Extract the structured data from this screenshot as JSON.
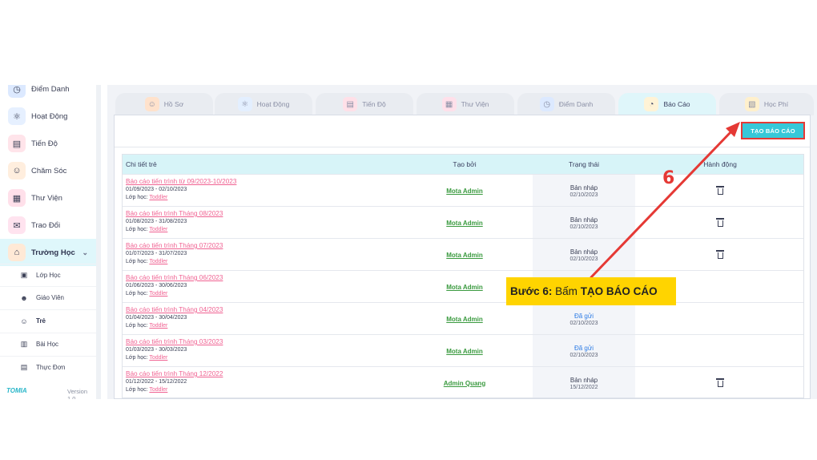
{
  "sidebar": {
    "items": [
      {
        "label": "Điểm Danh",
        "icon": "clock-icon",
        "color": "#dce9ff",
        "glyph": "◷"
      },
      {
        "label": "Hoạt Động",
        "icon": "atom-icon",
        "color": "#e6f0ff",
        "glyph": "⚛"
      },
      {
        "label": "Tiến Độ",
        "icon": "chart-board-icon",
        "color": "#ffe4ea",
        "glyph": "▤"
      },
      {
        "label": "Chăm Sóc",
        "icon": "baby-care-icon",
        "color": "#ffeede",
        "glyph": "☺"
      },
      {
        "label": "Thư Viện",
        "icon": "library-icon",
        "color": "#ffe0ea",
        "glyph": "▦"
      },
      {
        "label": "Trao Đổi",
        "icon": "chat-icon",
        "color": "#ffe3ef",
        "glyph": "✉"
      },
      {
        "label": "Trường Học",
        "icon": "school-icon",
        "color": "#ffe9d6",
        "glyph": "⌂"
      }
    ],
    "sub_items": [
      {
        "label": "Lớp Học",
        "icon": "classroom-icon",
        "glyph": "▣"
      },
      {
        "label": "Giáo Viên",
        "icon": "teachers-icon",
        "glyph": "☻"
      },
      {
        "label": "Trẻ",
        "icon": "kids-icon",
        "glyph": "☺"
      },
      {
        "label": "Bài Học",
        "icon": "lesson-icon",
        "glyph": "▥"
      },
      {
        "label": "Thực Đơn",
        "icon": "menu-icon",
        "glyph": "▤"
      }
    ],
    "brand": "TOMIA",
    "version": "Version 1.0"
  },
  "tabs": [
    {
      "label": "Hồ Sơ",
      "icon": "profile-icon",
      "color": "#ffe2cc",
      "glyph": "☺"
    },
    {
      "label": "Hoạt Động",
      "icon": "atom-icon",
      "color": "#e3efff",
      "glyph": "⚛"
    },
    {
      "label": "Tiến Độ",
      "icon": "chart-board-icon",
      "color": "#ffe0e8",
      "glyph": "▤"
    },
    {
      "label": "Thư Viện",
      "icon": "library-icon",
      "color": "#ffe0ea",
      "glyph": "▦"
    },
    {
      "label": "Điểm Danh",
      "icon": "clock-icon",
      "color": "#dce9ff",
      "glyph": "◷"
    },
    {
      "label": "Báo Cáo",
      "icon": "report-pie-icon",
      "color": "#fff3d6",
      "glyph": "◔"
    },
    {
      "label": "Học Phí",
      "icon": "tuition-icon",
      "color": "#fff0cc",
      "glyph": "▧"
    }
  ],
  "toolbar": {
    "create_label": "TẠO BÁO CÁO"
  },
  "table": {
    "headers": [
      "Chi tiết trẻ",
      "Tạo bởi",
      "Trạng thái",
      "Hành động"
    ],
    "rows": [
      {
        "title": "Báo cáo tiến trình từ 09/2023-10/2023",
        "range": "01/09/2023 - 02/10/2023",
        "class_prefix": "Lớp học:",
        "class_name": "Toddler",
        "creator": "Mota Admin",
        "status": "Bản nháp",
        "status_date": "02/10/2023",
        "sent": false,
        "deletable": true
      },
      {
        "title": "Báo cáo tiến trình Tháng 08/2023",
        "range": "01/08/2023 - 31/08/2023",
        "class_prefix": "Lớp học:",
        "class_name": "Toddler",
        "creator": "Mota Admin",
        "status": "Bản nháp",
        "status_date": "02/10/2023",
        "sent": false,
        "deletable": true
      },
      {
        "title": "Báo cáo tiến trình Tháng 07/2023",
        "range": "01/07/2023 - 31/07/2023",
        "class_prefix": "Lớp học:",
        "class_name": "Toddler",
        "creator": "Mota Admin",
        "status": "Bản nháp",
        "status_date": "02/10/2023",
        "sent": false,
        "deletable": true
      },
      {
        "title": "Báo cáo tiến trình Tháng 06/2023",
        "range": "01/06/2023 - 30/06/2023",
        "class_prefix": "Lớp học:",
        "class_name": "Toddler",
        "creator": "Mota Admin",
        "status": "",
        "status_date": "",
        "sent": false,
        "deletable": false
      },
      {
        "title": "Báo cáo tiến trình Tháng 04/2023",
        "range": "01/04/2023 - 30/04/2023",
        "class_prefix": "Lớp học:",
        "class_name": "Toddler",
        "creator": "Mota Admin",
        "status": "Đã gửi",
        "status_date": "02/10/2023",
        "sent": true,
        "deletable": false
      },
      {
        "title": "Báo cáo tiến trình Tháng 03/2023",
        "range": "01/03/2023 - 30/03/2023",
        "class_prefix": "Lớp học:",
        "class_name": "Toddler",
        "creator": "Mota Admin",
        "status": "Đã gửi",
        "status_date": "02/10/2023",
        "sent": true,
        "deletable": false
      },
      {
        "title": "Báo cáo tiến trình Tháng 12/2022",
        "range": "01/12/2022 - 15/12/2022",
        "class_prefix": "Lớp học:",
        "class_name": "Toddler",
        "creator": "Admin Quang",
        "status": "Bản nháp",
        "status_date": "15/12/2022",
        "sent": false,
        "deletable": true
      }
    ]
  },
  "annotation": {
    "step_number": "6",
    "callout_prefix": "Bước 6:",
    "callout_action": "Bấm",
    "callout_target": "TẠO BÁO CÁO",
    "arrow_color": "#e53935",
    "highlight_color": "#ffd400"
  }
}
